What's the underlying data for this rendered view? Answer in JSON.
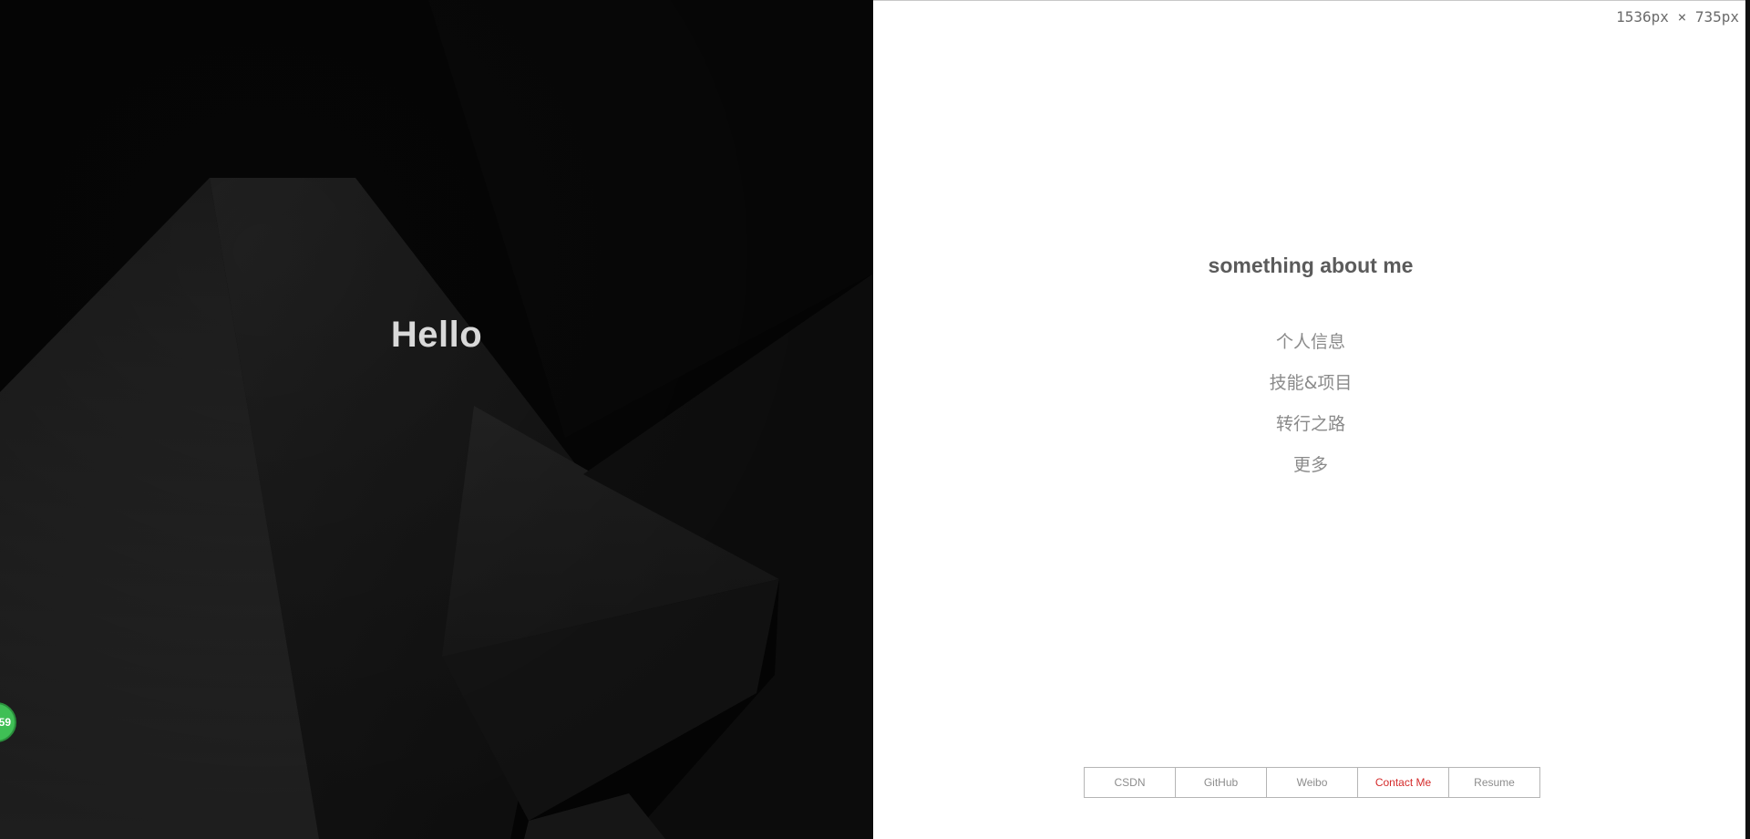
{
  "left": {
    "greeting": "Hello",
    "badge_text": "59"
  },
  "viewport_readout": "1536px × 735px",
  "about": {
    "title": "something about me",
    "menu": [
      {
        "label": "个人信息"
      },
      {
        "label": "技能&项目"
      },
      {
        "label": "转行之路"
      },
      {
        "label": "更多"
      }
    ]
  },
  "links": [
    {
      "label": "CSDN",
      "active": false
    },
    {
      "label": "GitHub",
      "active": false
    },
    {
      "label": "Weibo",
      "active": false
    },
    {
      "label": "Contact Me",
      "active": true
    },
    {
      "label": "Resume",
      "active": false
    }
  ],
  "colors": {
    "accent_active_link": "#d42a2a",
    "badge": "#3fbf55",
    "dark_bg": "#070707"
  }
}
